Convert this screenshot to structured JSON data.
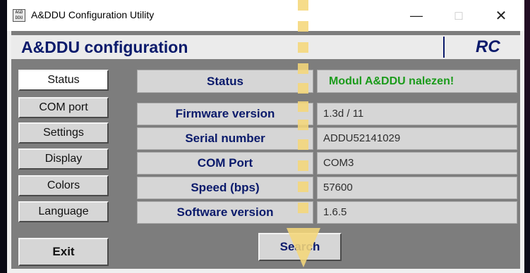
{
  "window": {
    "icon_text": "A&D DDU",
    "title": "A&DDU Configuration Utility",
    "controls": {
      "minimize": "—",
      "maximize": "□",
      "close": "✕"
    }
  },
  "header": {
    "title": "A&DDU configuration",
    "badge": "RC"
  },
  "nav": {
    "items": [
      {
        "label": "Status",
        "active": true
      },
      {
        "label": "COM port",
        "active": false
      },
      {
        "label": "Settings",
        "active": false
      },
      {
        "label": "Display",
        "active": false
      },
      {
        "label": "Colors",
        "active": false
      },
      {
        "label": "Language",
        "active": false
      }
    ],
    "exit_label": "Exit"
  },
  "status": {
    "label": "Status",
    "value": "Modul A&DDU nalezen!",
    "value_color": "#1b9b1b"
  },
  "info": {
    "rows": [
      {
        "label": "Firmware version",
        "value": "1.3d / 11"
      },
      {
        "label": "Serial number",
        "value": "ADDU52141029"
      },
      {
        "label": "COM Port",
        "value": "COM3"
      },
      {
        "label": "Speed (bps)",
        "value": "57600"
      },
      {
        "label": "Software version",
        "value": "1.6.5"
      }
    ]
  },
  "search_label": "Search",
  "colors": {
    "accent": "#0a1a6b",
    "panel": "#7d7d7d",
    "highlight": "#f5d77a"
  }
}
